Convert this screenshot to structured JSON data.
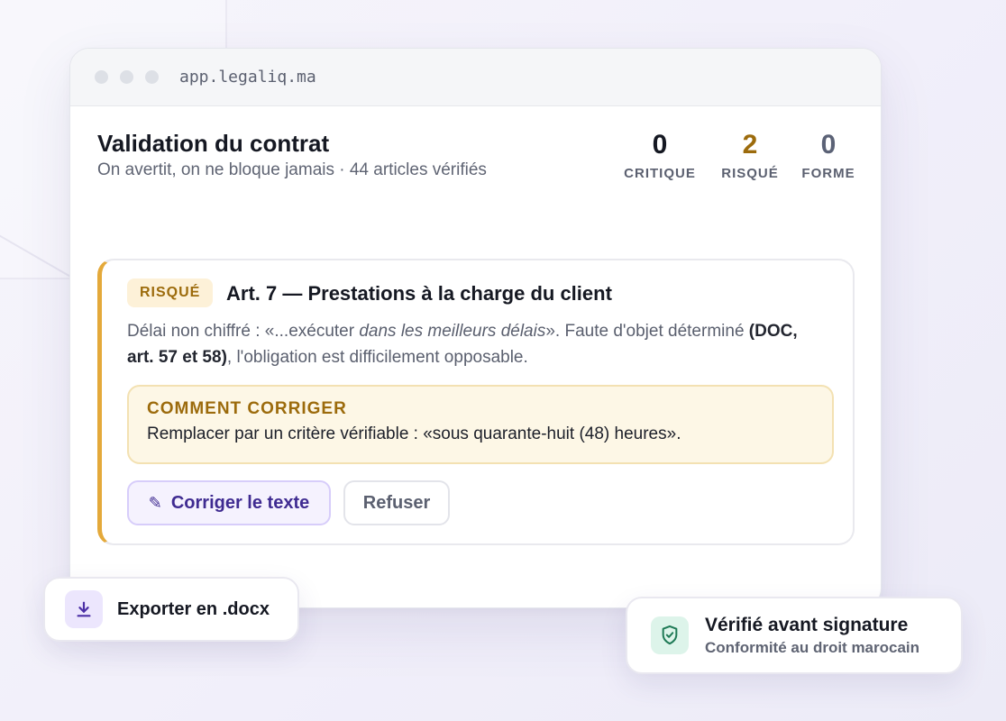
{
  "browser": {
    "url": "app.legaliq.ma"
  },
  "header": {
    "title": "Validation du contrat",
    "subtitle": "On avertit, on ne bloque jamais · 44 articles vérifiés"
  },
  "stats": [
    {
      "value": "0",
      "label": "CRITIQUE",
      "color": "#151822"
    },
    {
      "value": "2",
      "label": "RISQUÉ",
      "color": "#9c6b0c"
    },
    {
      "value": "0",
      "label": "FORME",
      "color": "#5b6276"
    }
  ],
  "issue": {
    "tag": "RISQUÉ",
    "title": "Art. 7 — Prestations à la charge du client",
    "desc_part1": "Délai non chiffré : «...exécuter ",
    "desc_italic": "dans les meilleurs délais",
    "desc_part2": "». Faute d'objet déterminé ",
    "desc_bold": "(DOC, art. 57 et 58)",
    "desc_part3": ", l'obligation est difficilement opposable.",
    "fix_heading": "COMMENT CORRIGER",
    "fix_text": "Remplacer par un critère vérifiable : «sous quarante-huit (48) heures».",
    "fix_button": "Corriger le texte",
    "refuse_button": "Refuser"
  },
  "export": {
    "label": "Exporter en .docx"
  },
  "badge": {
    "title": "Vérifié avant signature",
    "subtitle": "Conformité au droit marocain"
  },
  "colors": {
    "accent_purple": "#3f2b91",
    "warning_amber": "#e4a93a",
    "success_green": "#1f7a56"
  },
  "icons": [
    "pencil-icon",
    "download-icon",
    "shield-check-icon"
  ]
}
